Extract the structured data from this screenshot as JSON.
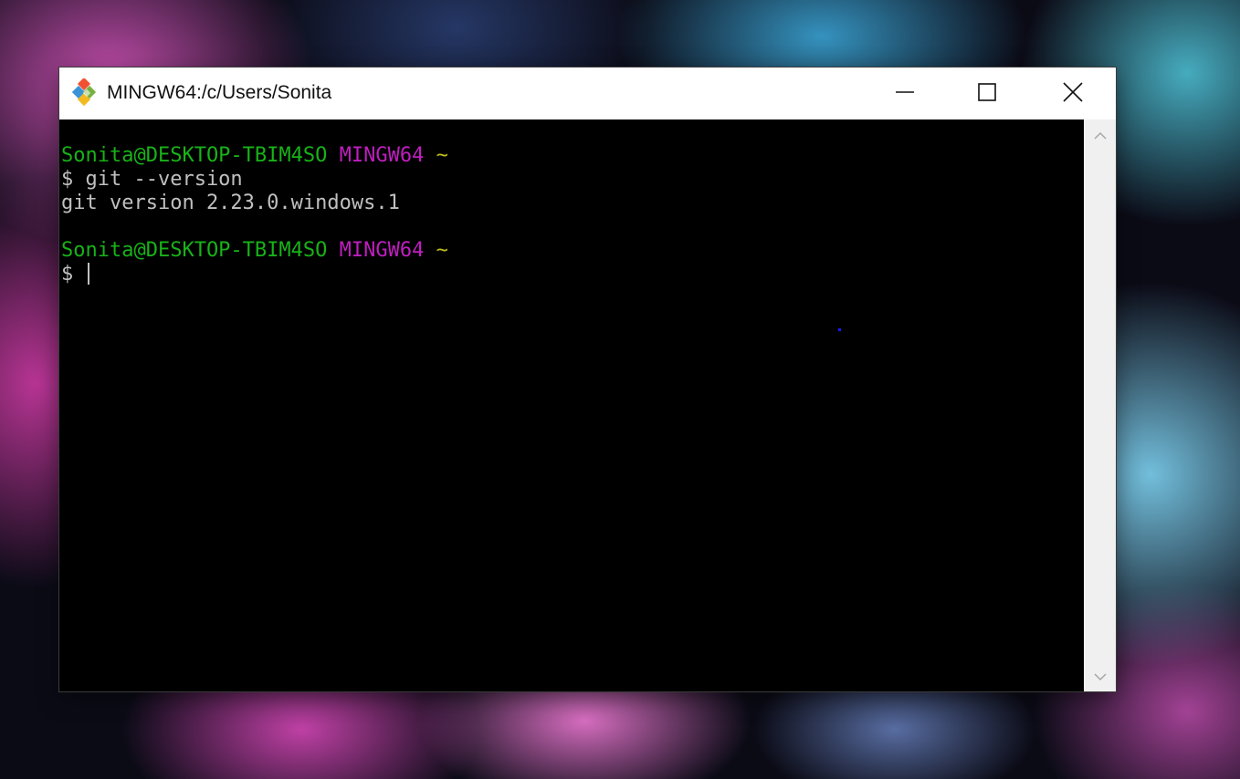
{
  "window": {
    "title": "MINGW64:/c/Users/Sonita",
    "icon": "git-for-windows-icon",
    "controls": {
      "minimize_icon": "minimize-icon",
      "maximize_icon": "maximize-icon",
      "close_icon": "close-icon"
    }
  },
  "terminal": {
    "colors": {
      "background": "#000000",
      "text": "#c0c0c0",
      "user_host": "#18b218",
      "system": "#bf1ebf",
      "path": "#bfbf18"
    },
    "prompt1": {
      "user_host": "Sonita@DESKTOP-TBIM4SO",
      "system": "MINGW64",
      "path": "~"
    },
    "command1": "$ git --version",
    "output1": "git version 2.23.0.windows.1",
    "prompt2": {
      "user_host": "Sonita@DESKTOP-TBIM4SO",
      "system": "MINGW64",
      "path": "~"
    },
    "input_prompt": "$ "
  },
  "scrollbar": {
    "up_icon": "chevron-up-icon",
    "down_icon": "chevron-down-icon"
  }
}
